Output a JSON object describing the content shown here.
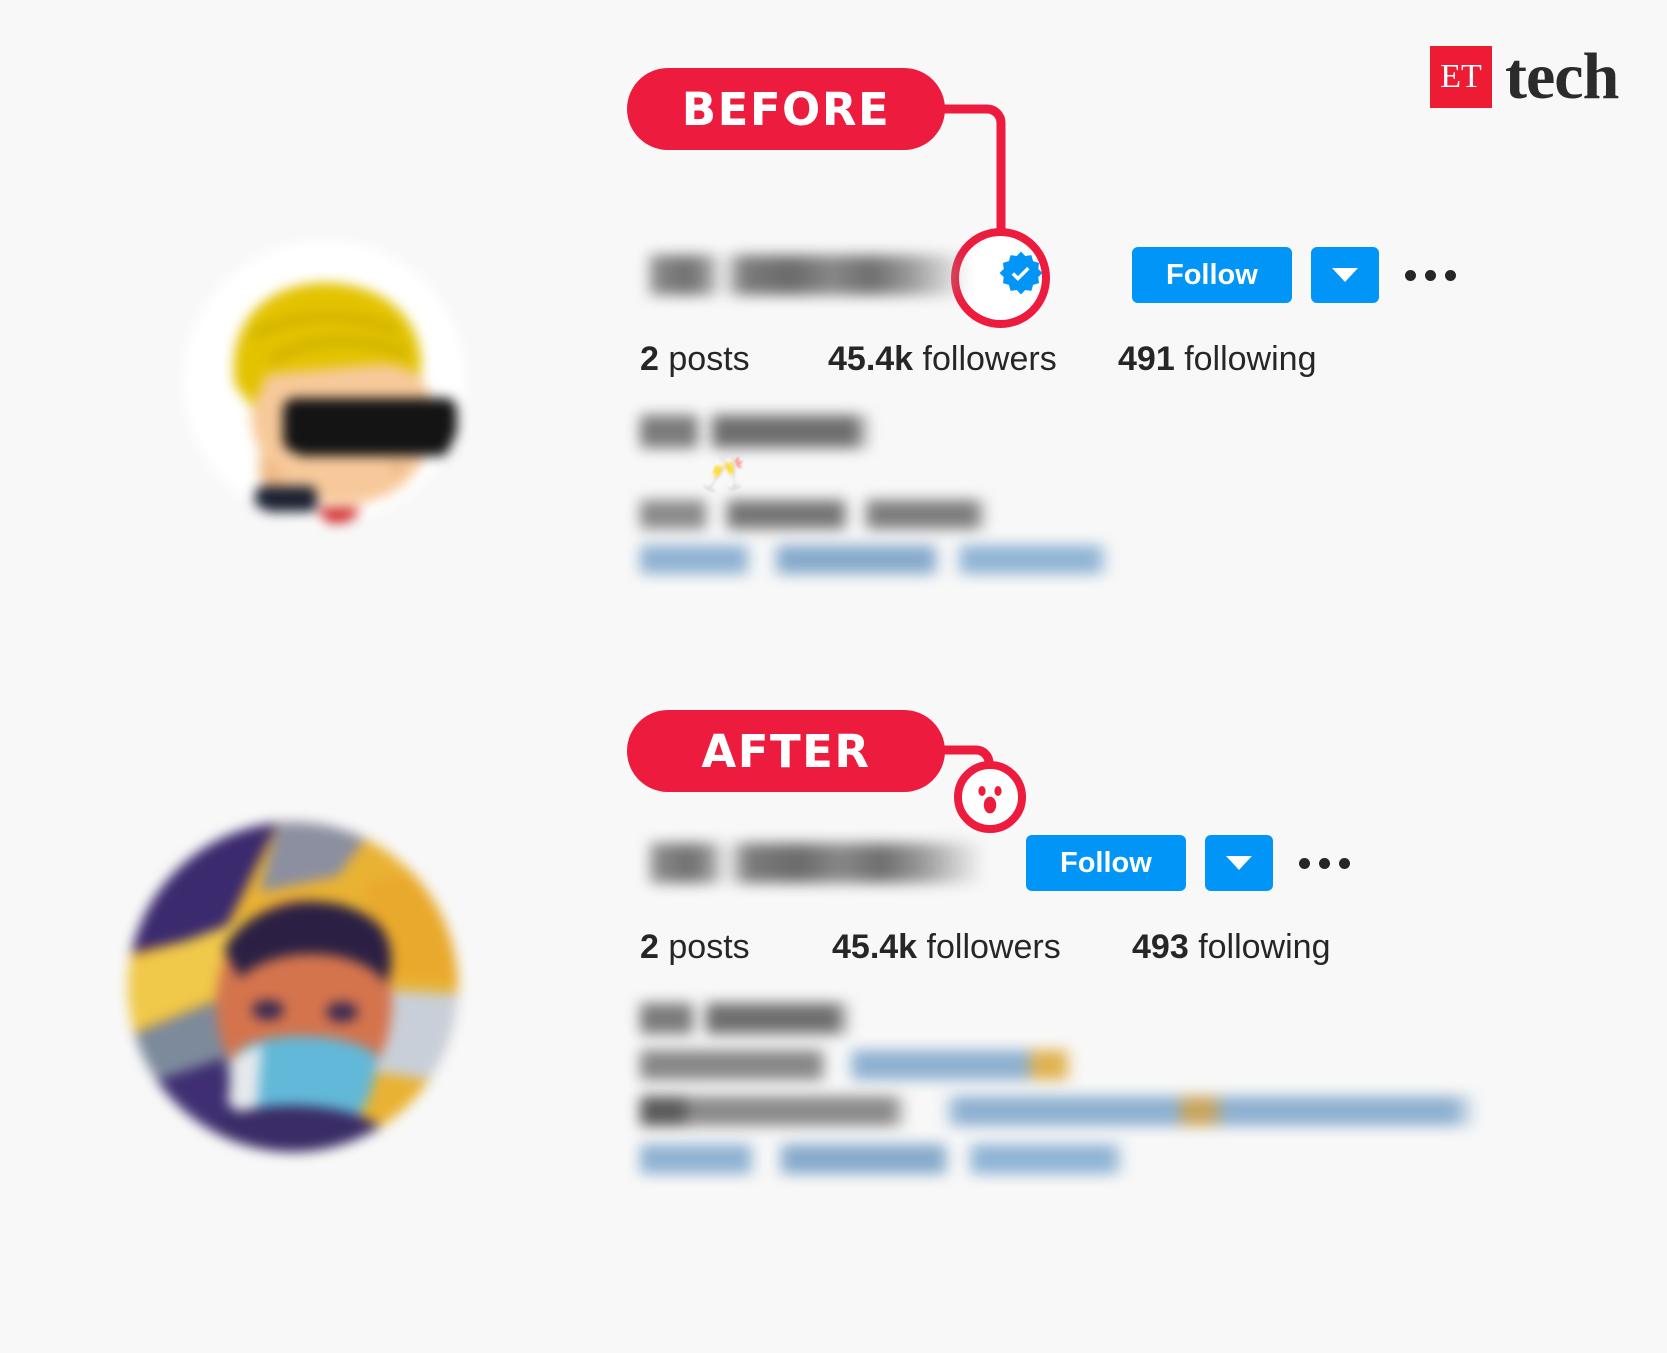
{
  "brand": {
    "mark_text": "ET",
    "word": "tech",
    "mark_color": "#ed1b34",
    "word_color": "#2b2b2b"
  },
  "annotations": {
    "accent_color": "#ed1b3e",
    "before": {
      "label": "BEFORE",
      "callout_target": "verified-badge",
      "target_icon": "verified-badge-icon"
    },
    "after": {
      "label": "AFTER",
      "callout_target": "missing-verified-badge",
      "target_icon": "shocked-face-icon"
    }
  },
  "profiles": [
    {
      "id": "before",
      "avatar_icon": "cartoon-avatar-sunglasses",
      "username": "",
      "verified": true,
      "verified_icon": "verified-badge-icon",
      "follow_label": "Follow",
      "caret_icon": "chevron-down-icon",
      "more_icon": "more-options-icon",
      "accent_button_color": "#0095f6",
      "stats": [
        {
          "value": "2",
          "label": "posts"
        },
        {
          "value": "45.4k",
          "label": "followers"
        },
        {
          "value": "491",
          "label": "following"
        }
      ],
      "bio": {
        "redacted": true,
        "emoji": "🥂",
        "lines": 3
      }
    },
    {
      "id": "after",
      "avatar_icon": "photo-avatar-face-mask",
      "username": "",
      "verified": false,
      "follow_label": "Follow",
      "caret_icon": "chevron-down-icon",
      "more_icon": "more-options-icon",
      "accent_button_color": "#0095f6",
      "stats": [
        {
          "value": "2",
          "label": "posts"
        },
        {
          "value": "45.4k",
          "label": "followers"
        },
        {
          "value": "493",
          "label": "following"
        }
      ],
      "bio": {
        "redacted": true,
        "lines": 4
      }
    }
  ]
}
